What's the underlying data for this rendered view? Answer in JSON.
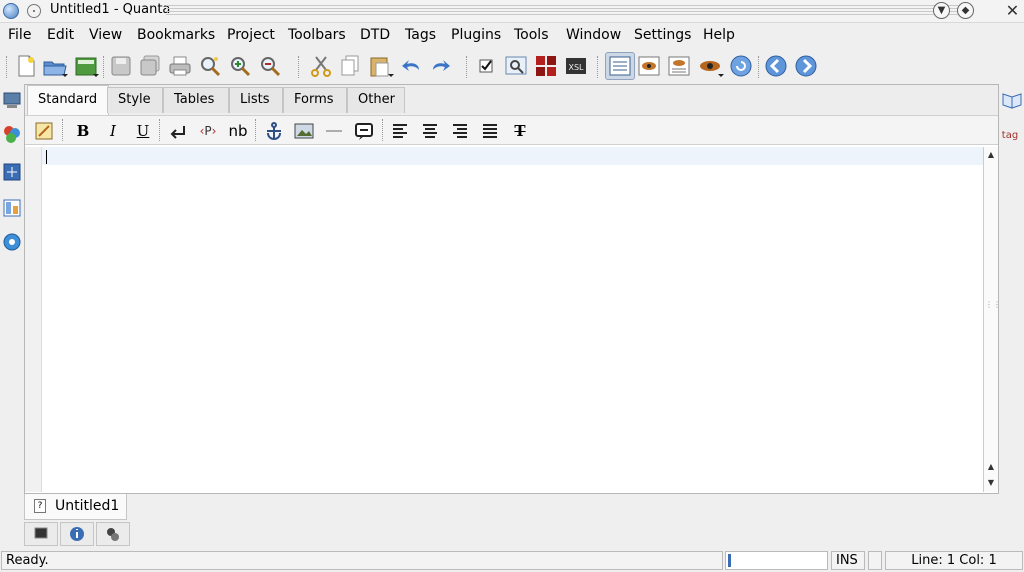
{
  "window": {
    "title": "Untitled1 - Quanta",
    "buttons": [
      "minimize",
      "maximize",
      "close"
    ]
  },
  "menubar": {
    "items": [
      {
        "label": "File"
      },
      {
        "label": "Edit"
      },
      {
        "label": "View"
      },
      {
        "label": "Bookmarks"
      },
      {
        "label": "Project"
      },
      {
        "label": "Toolbars"
      },
      {
        "label": "DTD"
      },
      {
        "label": "Tags"
      },
      {
        "label": "Plugins"
      },
      {
        "label": "Tools"
      },
      {
        "label": "Window"
      },
      {
        "label": "Settings"
      },
      {
        "label": "Help"
      }
    ]
  },
  "main_toolbar": {
    "icons": [
      "new-file-icon",
      "open-file-icon",
      "open-project-icon",
      "save-icon",
      "save-all-icon",
      "print-icon",
      "find-icon",
      "zoom-in-icon",
      "zoom-out-icon",
      "cut-icon",
      "copy-icon",
      "paste-icon",
      "undo-icon",
      "redo-icon",
      "check-icon",
      "inspect-icon",
      "plugin-icon",
      "xsl-icon",
      "source-view-icon",
      "preview-icon",
      "split-view-icon",
      "preview-browser-icon",
      "reload-icon",
      "back-icon",
      "forward-icon"
    ],
    "xsl_label": "XSL"
  },
  "tag_tabs": {
    "items": [
      {
        "label": "Standard",
        "active": true
      },
      {
        "label": "Style"
      },
      {
        "label": "Tables"
      },
      {
        "label": "Lists"
      },
      {
        "label": "Forms"
      },
      {
        "label": "Other"
      }
    ]
  },
  "tag_toolbar": {
    "bold": "B",
    "italic": "I",
    "underline": "U",
    "paragraph": "P",
    "nbsp": "nb",
    "tt": "T"
  },
  "documents": {
    "tabs": [
      {
        "label": "Untitled1"
      }
    ]
  },
  "statusbar": {
    "message": "Ready.",
    "mode": "INS",
    "position": "Line: 1 Col: 1"
  },
  "right_dock": {
    "tag_label": "tag"
  }
}
